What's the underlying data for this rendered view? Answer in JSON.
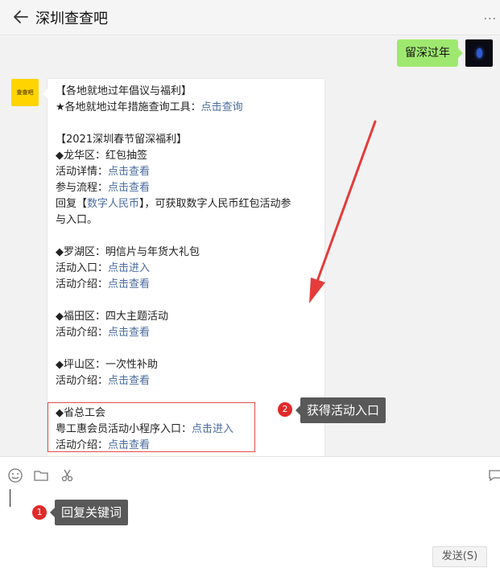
{
  "header": {
    "title": "深圳查查吧",
    "back_icon": "back-arrow-icon",
    "more_icon": "more-icon"
  },
  "my_message": {
    "text": "留深过年"
  },
  "bot": {
    "avatar_label": "查查吧",
    "lines": [
      {
        "text": "【各地就地过年倡议与福利】"
      },
      {
        "text": "★各地就地过年措施查询工具：",
        "link": "点击查询"
      },
      {
        "text": ""
      },
      {
        "text": "【2021深圳春节留深福利】"
      },
      {
        "text": "◆龙华区：红包抽签"
      },
      {
        "text": "活动详情：",
        "link": "点击查看"
      },
      {
        "text": "参与流程：",
        "link": "点击查看"
      },
      {
        "text": "回复【",
        "link": "数字人民币",
        "after": "】，可获取数字人民币红包活动参"
      },
      {
        "text": "与入口。"
      },
      {
        "text": ""
      },
      {
        "text": "◆罗湖区：明信片与年货大礼包"
      },
      {
        "text": "活动入口：",
        "link": "点击进入"
      },
      {
        "text": "活动介绍：",
        "link": "点击查看"
      },
      {
        "text": ""
      },
      {
        "text": "◆福田区：四大主题活动"
      },
      {
        "text": "活动介绍：",
        "link": "点击查看"
      },
      {
        "text": ""
      },
      {
        "text": "◆坪山区：一次性补助"
      },
      {
        "text": "活动介绍：",
        "link": "点击查看"
      },
      {
        "text": ""
      },
      {
        "text": "◆省总工会"
      },
      {
        "text": "粤工惠会员活动小程序入口：",
        "link": "点击进入"
      },
      {
        "text": "活动介绍：",
        "link": "点击查看"
      }
    ]
  },
  "annotations": [
    {
      "num": "1",
      "text": "回复关键词"
    },
    {
      "num": "2",
      "text": "获得活动入口"
    }
  ],
  "toolbar": {
    "icons": [
      "emoji-icon",
      "folder-icon",
      "scissors-icon",
      "chat-bubble-icon"
    ]
  },
  "send_button": "发送(S)",
  "colors": {
    "my_bubble": "#9fe870",
    "link": "#4a6c9f",
    "highlight": "#e34a4a",
    "arrow": "#e53b3b",
    "tip_bg": "#595959",
    "num_bg": "#e12a2a"
  }
}
